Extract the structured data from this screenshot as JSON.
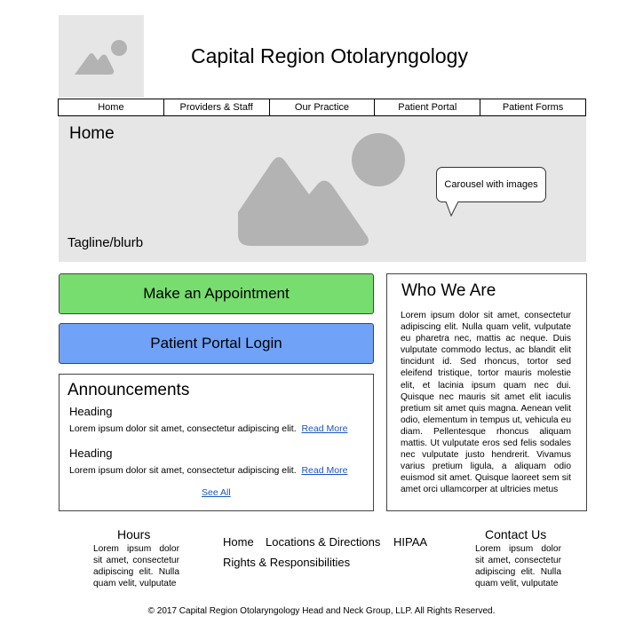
{
  "header": {
    "site_title": "Capital Region Otolaryngology"
  },
  "nav": {
    "items": [
      "Home",
      "Providers & Staff",
      "Our Practice",
      "Patient Portal",
      "Patient Forms"
    ]
  },
  "hero": {
    "title": "Home",
    "tagline": "Tagline/blurb",
    "callout": "Carousel with images"
  },
  "actions": {
    "appointment_label": "Make an Appointment",
    "portal_label": "Patient Portal Login"
  },
  "announcements": {
    "title": "Announcements",
    "items": [
      {
        "heading": "Heading",
        "text": "Lorem ipsum dolor sit amet, consectetur adipiscing elit.",
        "link": "Read More"
      },
      {
        "heading": "Heading",
        "text": "Lorem ipsum dolor sit amet, consectetur adipiscing elit.",
        "link": "Read More"
      }
    ],
    "see_all": "See All"
  },
  "who": {
    "title": "Who We Are",
    "text": "Lorem ipsum dolor sit amet, consectetur adipiscing elit. Nulla quam velit, vulputate eu pharetra nec, mattis ac neque. Duis vulputate commodo lectus, ac blandit elit tincidunt id. Sed rhoncus, tortor sed eleifend tristique, tortor mauris molestie elit, et lacinia ipsum quam nec dui. Quisque nec mauris sit amet elit iaculis pretium sit amet quis magna. Aenean velit odio, elementum in tempus ut, vehicula eu diam. Pellentesque rhoncus aliquam mattis. Ut vulputate eros sed felis sodales nec vulputate justo hendrerit. Vivamus varius pretium ligula, a aliquam odio euismod sit amet. Quisque laoreet sem sit amet orci ullamcorper at ultricies metus"
  },
  "footer": {
    "hours_title": "Hours",
    "hours_text": "Lorem ipsum dolor sit amet, consectetur adipiscing elit. Nulla quam velit, vulputate",
    "links": [
      "Home",
      "Locations & Directions",
      "HIPAA",
      "Rights & Responsibilities"
    ],
    "contact_title": "Contact Us",
    "contact_text": "Lorem ipsum dolor sit amet, consectetur adipiscing elit. Nulla quam velit, vulputate",
    "copyright": "© 2017 Capital Region Otolaryngology Head and Neck Group, LLP. All Rights Reserved."
  },
  "colors": {
    "appointment": "#77dd6e",
    "portal": "#70a2f7",
    "placeholder_bg": "#e6e6e6",
    "placeholder_shape": "#b3b3b3",
    "link": "#1a55c4"
  }
}
